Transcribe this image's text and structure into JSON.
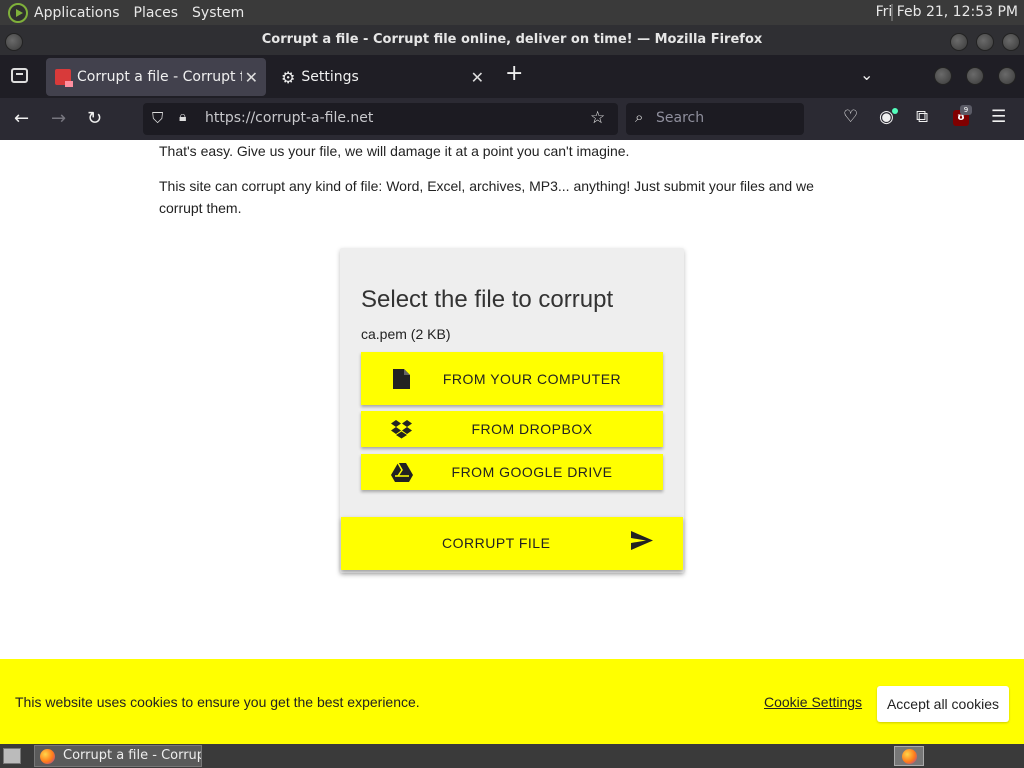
{
  "system_panel": {
    "menus": [
      "Applications",
      "Places",
      "System"
    ],
    "clock": "Fri Feb 21, 12:53 PM"
  },
  "window": {
    "title": "Corrupt a file - Corrupt file online, deliver on time! — Mozilla Firefox"
  },
  "tabs": [
    {
      "title": "Corrupt a file - Corrupt file online, deliver on time!",
      "active": true
    },
    {
      "title": "Settings",
      "active": false
    }
  ],
  "navbar": {
    "url": "https://corrupt-a-file.net",
    "search_placeholder": "Search",
    "ublock_count": "9"
  },
  "page": {
    "intro_line1": "That's easy. Give us your file, we will damage it at a point you can't imagine.",
    "intro_line2": "This site can corrupt any kind of file: Word, Excel, archives, MP3... anything! Just submit your files and we corrupt them.",
    "card_title": "Select the file to corrupt",
    "file_info": "ca.pem (2 KB)",
    "buttons": {
      "from_computer": "FROM YOUR COMPUTER",
      "from_dropbox": "FROM DROPBOX",
      "from_drive": "FROM GOOGLE DRIVE",
      "corrupt": "CORRUPT FILE"
    },
    "accent_color": "#ffff00"
  },
  "cookie_banner": {
    "message": "This website uses cookies to ensure you get the best experience.",
    "settings_link": "Cookie Settings",
    "accept_button": "Accept all cookies"
  },
  "taskbar": {
    "task_label": "Corrupt a file - Corrupt file online, deliver on time!"
  }
}
